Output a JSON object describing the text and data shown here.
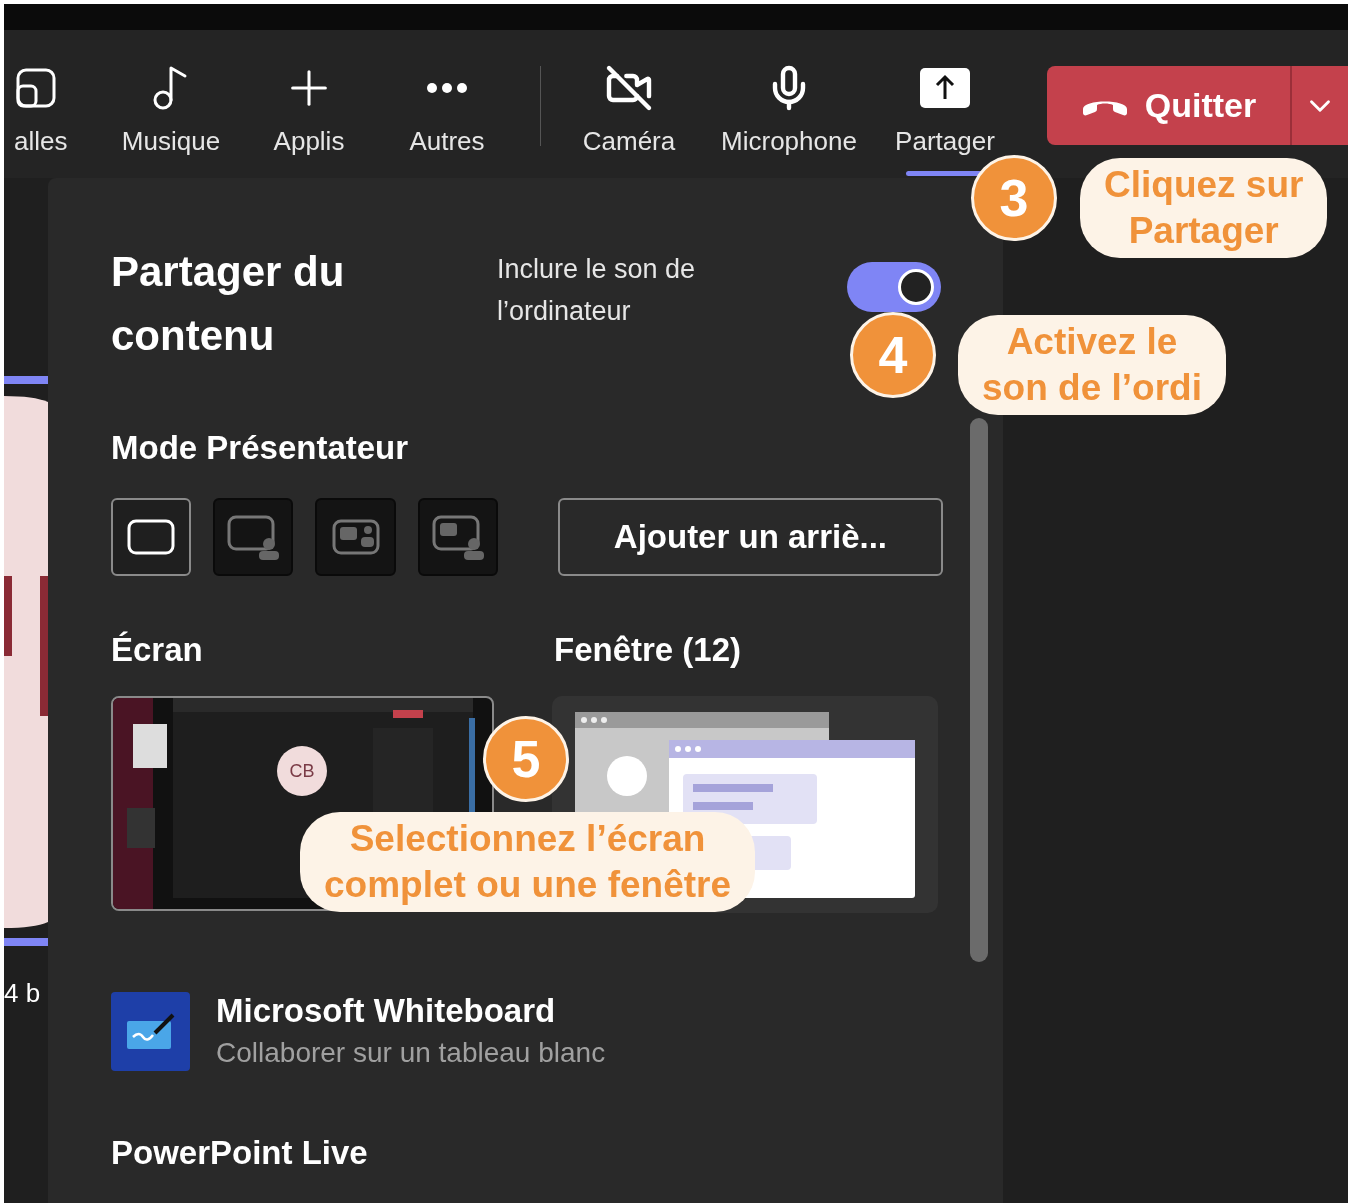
{
  "toolbar": {
    "items": [
      {
        "kind": "rooms",
        "label": "alles",
        "selected": false
      },
      {
        "kind": "music",
        "label": "Musique",
        "selected": false
      },
      {
        "kind": "apps",
        "label": "Applis",
        "selected": false
      },
      {
        "kind": "more",
        "label": "Autres",
        "selected": false
      },
      {
        "kind": "camera-off",
        "label": "Caméra",
        "selected": false
      },
      {
        "kind": "mic",
        "label": "Microphone",
        "selected": false
      },
      {
        "kind": "share",
        "label": "Partager",
        "selected": true
      }
    ],
    "quit_button": {
      "label": "Quitter"
    }
  },
  "participant": {
    "label": "4 b"
  },
  "panel": {
    "title": "Partager du contenu",
    "audio_toggle": {
      "label": "Inclure le son de l’ordinateur",
      "on": true
    },
    "presenter_mode": {
      "title": "Mode Présentateur",
      "modes": [
        {
          "kind": "content-only",
          "selected": true
        },
        {
          "kind": "standout",
          "selected": false
        },
        {
          "kind": "side-by-side",
          "selected": false
        },
        {
          "kind": "reporter",
          "selected": false
        }
      ],
      "background_button": "Ajouter un arriè..."
    },
    "screen": {
      "title": "Écran",
      "avatar": "CB"
    },
    "window": {
      "title": "Fenêtre (12)"
    },
    "apps": [
      {
        "name": "Microsoft Whiteboard",
        "description": "Collaborer sur un tableau blanc"
      },
      {
        "name": "PowerPoint Live"
      }
    ]
  },
  "callouts": [
    {
      "number": "3",
      "lines": [
        "Cliquez sur",
        "Partager"
      ]
    },
    {
      "number": "4",
      "lines": [
        "Activez le",
        "son de l’ordi"
      ]
    },
    {
      "number": "5",
      "lines": [
        "Selectionnez l’écran",
        "complet ou une fenêtre"
      ]
    }
  ]
}
